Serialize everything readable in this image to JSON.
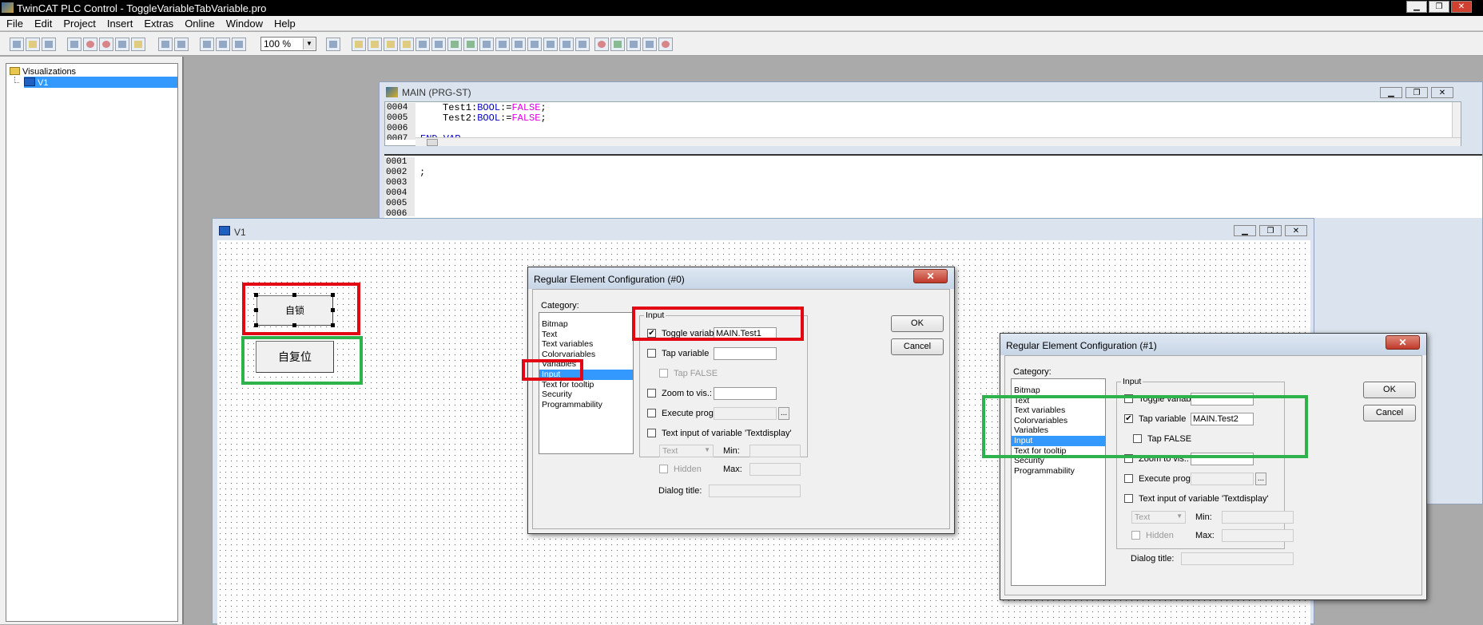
{
  "app": {
    "title": "TwinCAT PLC Control - ToggleVariableTabVariable.pro"
  },
  "menu": [
    "File",
    "Edit",
    "Project",
    "Insert",
    "Extras",
    "Online",
    "Window",
    "Help"
  ],
  "toolbar": {
    "zoom": "100 %"
  },
  "tree": {
    "root": "Visualizations",
    "child": "V1"
  },
  "main_window": {
    "title": "MAIN (PRG-ST)",
    "decl_lines": [
      {
        "num": "0004",
        "name": "Test1",
        "type": "BOOL",
        "assign": ":=",
        "value": "FALSE",
        "end": ";"
      },
      {
        "num": "0005",
        "name": "Test2",
        "type": "BOOL",
        "assign": ":=",
        "value": "FALSE",
        "end": ";"
      },
      {
        "num": "0006",
        "text": ""
      },
      {
        "num": "0007",
        "text": "END_VAR"
      }
    ],
    "impl_lines": [
      "0001",
      "0002",
      "0003",
      "0004",
      "0005",
      "0006"
    ],
    "impl_text": ";"
  },
  "v1_window": {
    "title": "V1",
    "button1": "自复位",
    "button1_visible": "自锁",
    "button2": "自复位"
  },
  "dialog0": {
    "title": "Regular Element Configuration (#0)",
    "category_label": "Category:",
    "categories": [
      "Bitmap",
      "Text",
      "Text variables",
      "Colorvariables",
      "Variables",
      "Input",
      "Text for tooltip",
      "Security",
      "Programmability"
    ],
    "selected": "Input",
    "group_title": "Input",
    "toggle_label": "Toggle variable",
    "toggle_checked": "✔",
    "toggle_value": "MAIN.Test1",
    "tap_label": "Tap variable",
    "tap_value": "",
    "tap_false_label": "Tap FALSE",
    "zoom_label": "Zoom to vis.:",
    "exec_label": "Execute program:",
    "ellipsis": "...",
    "text_input_label": "Text input of variable 'Textdisplay'",
    "text_select": "Text",
    "min_label": "Min:",
    "max_label": "Max:",
    "hidden_label": "Hidden",
    "dialog_title_label": "Dialog title:",
    "ok": "OK",
    "cancel": "Cancel"
  },
  "dialog1": {
    "title": "Regular Element Configuration (#1)",
    "category_label": "Category:",
    "categories": [
      "Bitmap",
      "Text",
      "Text variables",
      "Colorvariables",
      "Variables",
      "Input",
      "Text for tooltip",
      "Security",
      "Programmability"
    ],
    "selected": "Input",
    "group_title": "Input",
    "toggle_label": "Toggle variable",
    "tap_label": "Tap variable",
    "tap_checked": "✔",
    "tap_value": "MAIN.Test2",
    "tap_false_label": "Tap FALSE",
    "zoom_label": "Zoom to vis.:",
    "exec_label": "Execute program:",
    "ellipsis": "...",
    "text_input_label": "Text input of variable 'Textdisplay'",
    "text_select": "Text",
    "min_label": "Min:",
    "max_label": "Max:",
    "hidden_label": "Hidden",
    "dialog_title_label": "Dialog title:",
    "ok": "OK",
    "cancel": "Cancel"
  },
  "colors": {
    "highlight_red": "#e30613",
    "highlight_green": "#2eb24b",
    "selection": "#3399ff",
    "keyword": "#0000c0",
    "literal": "#e000e0"
  }
}
